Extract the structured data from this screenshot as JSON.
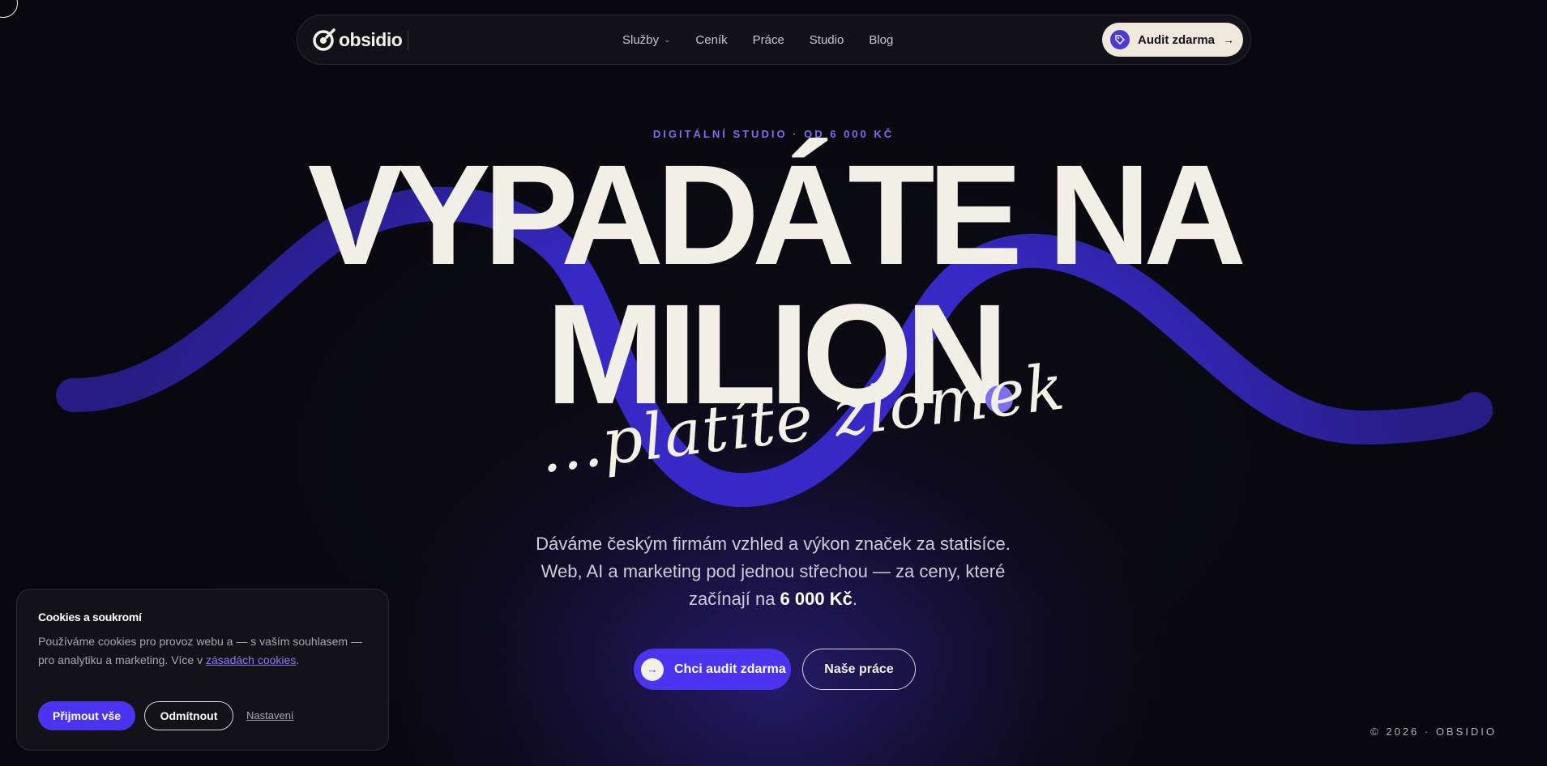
{
  "colors": {
    "background": "#0b0a12",
    "accent": "#4a34f0",
    "accent_light": "#7e6ef7",
    "cream": "#f2efe6"
  },
  "nav": {
    "logo_text": "obsidio",
    "logo_icon": "obsidio-logo-icon",
    "links": [
      {
        "label": "Služby",
        "has_dropdown": true
      },
      {
        "label": "Ceník"
      },
      {
        "label": "Práce"
      },
      {
        "label": "Studio"
      },
      {
        "label": "Blog"
      }
    ],
    "cta_label": "Audit zdarma",
    "cta_icon": "tag-icon",
    "cta_arrow": "→"
  },
  "hero": {
    "eyebrow": "DIGITÁLNÍ STUDIO · OD 6 000 KČ",
    "headline_line1": "VYPADÁTE NA",
    "headline_line2": "MILION",
    "script_text": "...platíte zlomek",
    "lead_before": "Dáváme českým firmám vzhled a výkon značek za statisíce. Web, AI a marketing pod jednou střechou — za ceny, které začínají na ",
    "lead_price": "6 000 Kč",
    "lead_after": ".",
    "primary_button": "Chci audit zdarma",
    "secondary_button": "Naše práce"
  },
  "footer_note": "© 2026 · OBSIDIO",
  "cookie": {
    "title": "Cookies a soukromí",
    "text_before": "Používáme cookies pro provoz webu a — s vaším souhlasem — pro analytiku a marketing. Více v ",
    "link_text": "zásadách cookies",
    "text_after": ".",
    "accept_label": "Přijmout vše",
    "reject_label": "Odmítnout",
    "settings_label": "Nastavení"
  }
}
